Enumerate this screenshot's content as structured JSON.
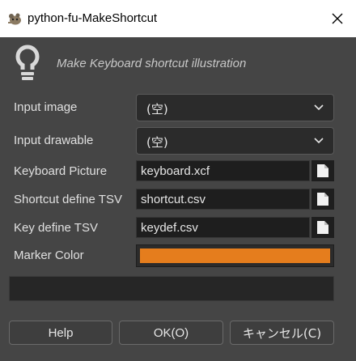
{
  "window": {
    "title": "python-fu-MakeShortcut",
    "close_icon": "close-icon"
  },
  "header": {
    "icon": "lightbulb-icon",
    "description": "Make Keyboard shortcut illustration"
  },
  "fields": {
    "input_image": {
      "label": "Input image",
      "value": "(空)"
    },
    "input_drawable": {
      "label": "Input drawable",
      "value": "(空)"
    },
    "keyboard_picture": {
      "label": "Keyboard Picture",
      "value": "keyboard.xcf"
    },
    "shortcut_define": {
      "label": "Shortcut define TSV",
      "value": "shortcut.csv"
    },
    "key_define": {
      "label": "Key define TSV",
      "value": "keydef.csv"
    },
    "marker_color": {
      "label": "Marker Color",
      "color": "#e57d1d"
    }
  },
  "buttons": {
    "help": "Help",
    "ok": "OK(O)",
    "cancel": "キャンセル(C)"
  }
}
